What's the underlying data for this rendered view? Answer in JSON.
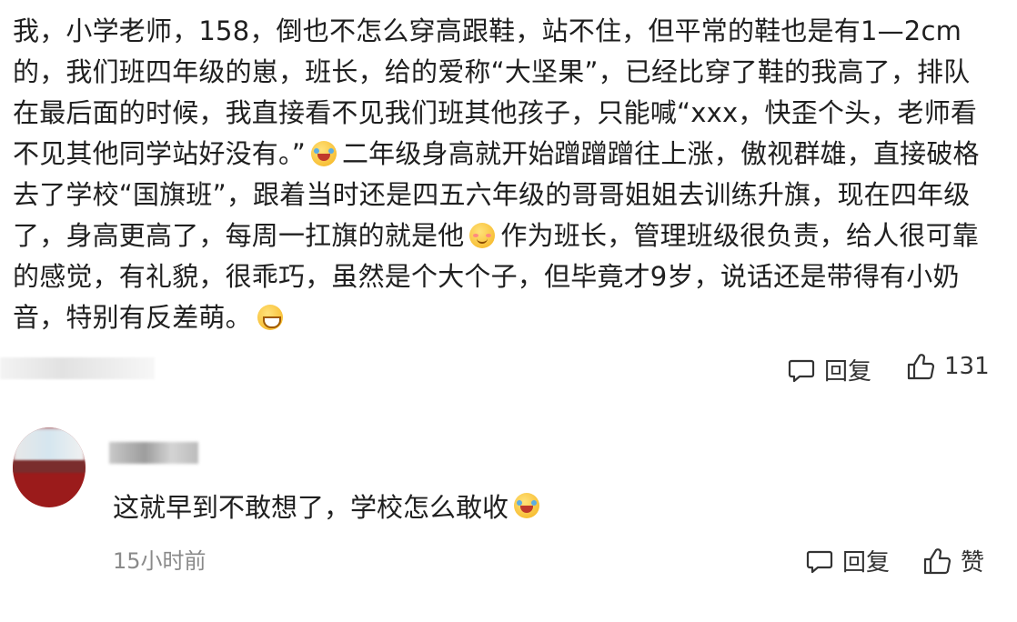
{
  "post": {
    "seg1": "我，小学老师，158，倒也不怎么穿高跟鞋，站不住，但平常的鞋也是有1—2cm的，我们班四年级的崽，班长，给的爱称“大坚果”，已经比穿了鞋的我高了，排队在最后面的时候，我直接看不见我们班其他孩子，只能喊“xxx，快歪个头，老师看不见其他同学站好没有。”",
    "seg2": "二年级身高就开始蹭蹭蹭往上涨，傲视群雄，直接破格去了学校“国旗班”，跟着当时还是四五六年级的哥哥姐姐去训练升旗，现在四年级了，身高更高了，每周一扛旗的就是他",
    "seg3": "作为班长，管理班级很负责，给人很可靠的感觉，有礼貌，很乖巧，虽然是个大个子，但毕竟才9岁，说话还是带得有小奶音，特别有反差萌。",
    "emoji1": "laugh-cry-emoji",
    "emoji2": "shy-emoji",
    "emoji3": "grin-emoji"
  },
  "post_actions": {
    "reply_label": "回复",
    "like_count": "131"
  },
  "reply": {
    "text": "这就早到不敢想了，学校怎么敢收",
    "emoji": "laugh-cry-emoji",
    "time": "15小时前",
    "reply_label": "回复",
    "like_label": "赞"
  },
  "icons": {
    "comment": "comment-bubble-icon",
    "like": "thumbs-up-icon"
  }
}
